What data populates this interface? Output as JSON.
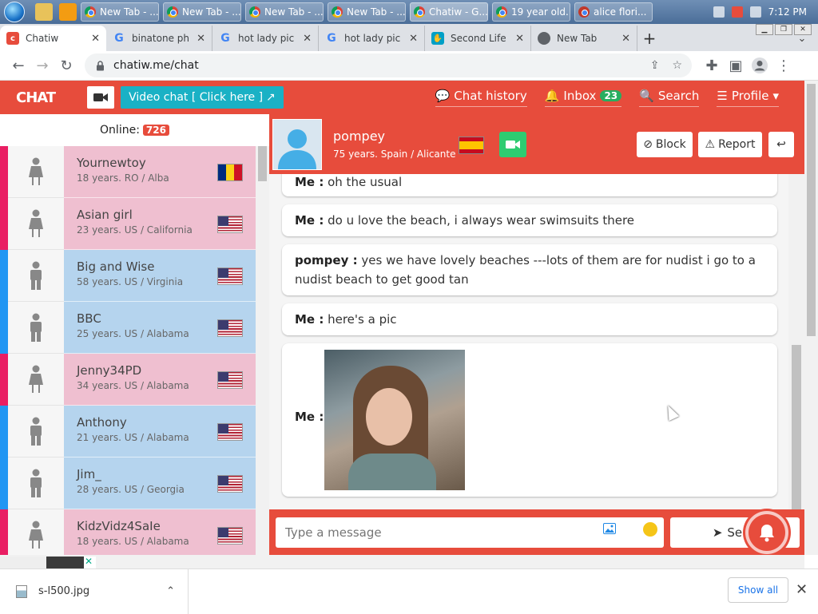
{
  "taskbar": {
    "tasks": [
      "New Tab - ...",
      "New Tab - ...",
      "New Tab - ...",
      "New Tab - ...",
      "Chatiw - G...",
      "19 year old...",
      "alice flori..."
    ],
    "clock": "7:12 PM"
  },
  "tabs": [
    {
      "title": "Chatiw",
      "active": true
    },
    {
      "title": "binatone ph"
    },
    {
      "title": "hot lady pic"
    },
    {
      "title": "hot lady pic"
    },
    {
      "title": "Second Life"
    },
    {
      "title": "New Tab"
    }
  ],
  "address_bar": {
    "url": "chatiw.me/chat"
  },
  "site_header": {
    "logo": "CHAT",
    "video_chat": "Video chat  [ Click here ]",
    "nav": {
      "history": "Chat history",
      "inbox": "Inbox",
      "inbox_count": "23",
      "search": "Search",
      "profile": "Profile"
    }
  },
  "sidebar": {
    "online_label": "Online:",
    "online_count": "726",
    "users": [
      {
        "name": "Yournewtoy",
        "meta": "18 years. RO / Alba",
        "gender": "f",
        "flag": "ro"
      },
      {
        "name": "Asian girl",
        "meta": "23 years. US / California",
        "gender": "f",
        "flag": "us"
      },
      {
        "name": "Big and Wise",
        "meta": "58 years. US / Virginia",
        "gender": "m",
        "flag": "us"
      },
      {
        "name": "BBC",
        "meta": "25 years. US / Alabama",
        "gender": "m",
        "flag": "us"
      },
      {
        "name": "Jenny34PD",
        "meta": "34 years. US / Alabama",
        "gender": "f",
        "flag": "us"
      },
      {
        "name": "Anthony",
        "meta": "21 years. US / Alabama",
        "gender": "m",
        "flag": "us"
      },
      {
        "name": "Jim_",
        "meta": "28 years. US / Georgia",
        "gender": "m",
        "flag": "us"
      },
      {
        "name": "KidzVidz4SaIe",
        "meta": "18 years. US / Alabama",
        "gender": "f",
        "flag": "us"
      }
    ]
  },
  "chat": {
    "partner": {
      "name": "pompey",
      "meta": "75 years. Spain / Alicante"
    },
    "buttons": {
      "block": "Block",
      "report": "Report"
    },
    "messages": [
      {
        "sender": "Me :",
        "text": "oh the usual"
      },
      {
        "sender": "Me :",
        "text": "do u love the beach, i always wear swimsuits there"
      },
      {
        "sender": "pompey :",
        "text": "yes we have lovely beaches ---lots of them are for nudist i go to a nudist beach to get good tan"
      },
      {
        "sender": "Me :",
        "text": "here's a pic"
      },
      {
        "sender": "Me :",
        "text": ""
      }
    ],
    "composer": {
      "placeholder": "Type a message",
      "send": "Send"
    }
  },
  "downloads": {
    "file": "s-l500.jpg",
    "show_all": "Show all"
  },
  "colors": {
    "brand_red": "#e74c3c",
    "video_teal": "#1ab1c5",
    "female_pink": "#efbfd0",
    "male_blue": "#b5d4ee"
  }
}
